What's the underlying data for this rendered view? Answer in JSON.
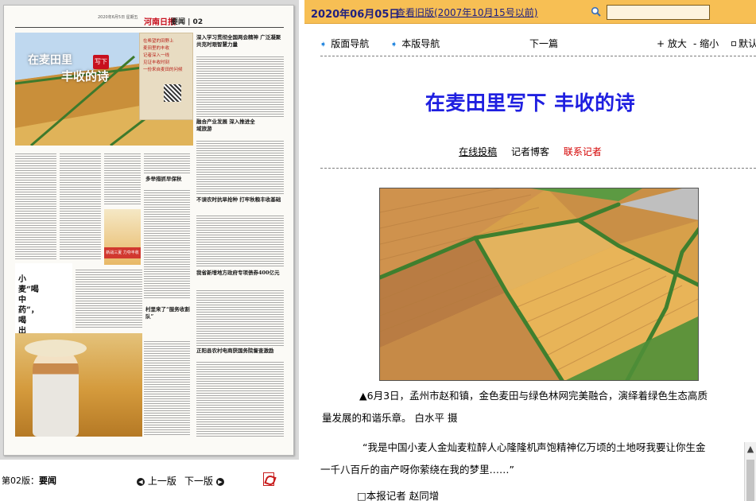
{
  "paper": {
    "masthead_date": "2020年6月5日 星期五",
    "brand": "河南日报",
    "section": "要闻 | 02",
    "hero_title_line1": "在麦田里",
    "hero_title_seal": "写下",
    "hero_title_line2": "丰收的诗",
    "side_box_lines": [
      "在希望的田野上",
      "麦田里的丰收",
      "记者深入一线",
      "见证丰收时刻",
      "一份来自麦田的问候"
    ],
    "headlines": [
      "深入学习贯彻全国两会精神 广泛凝聚共克时艰智慧力量",
      "融合产业发展 深入推进全域旅游",
      "多举措抓早保秋",
      "不误农时抗旱抢种 打牢秋粮丰收基础",
      "我省新增地方政府专项债券400亿元",
      "村里来了“服务收割队”",
      "正阳县农村电商获国务院督查激励"
    ],
    "sub_big_text": "小麦“喝中药”，喝出啥疗效？",
    "banner_text": "新战三夏 力夺丰收"
  },
  "left_footer": {
    "edition_prefix": "第02版：",
    "edition_name": "要闻",
    "prev_label": "上一版",
    "next_label": "下一版",
    "prev_icon": "round-left-arrow-icon",
    "next_icon": "round-right-arrow-icon",
    "pdf_icon": "pdf-icon"
  },
  "top_bar": {
    "date": "2020年06月05日",
    "old_version_link": "查看旧版(2007年10月15号以前)",
    "search_icon": "search-icon",
    "search_value": ""
  },
  "nav": {
    "version_nav": "版面导航",
    "article_nav": "本版导航",
    "next_article": "下一篇",
    "zoom_in": "+ 放大",
    "zoom_out": "- 缩小",
    "default_size": "默认"
  },
  "article": {
    "title": "在麦田里写下 丰收的诗",
    "online_submit": "在线投稿",
    "reporter_blog": "记者博客",
    "contact_reporter": "联系记者",
    "photo_alt": "孟州市赵和镇麦田与绿色林网航拍",
    "caption_line1": "▲6月3日，孟州市赵和镇，金色麦田与绿色林网完美融合，演绎着绿色生态高质",
    "caption_line2": "量发展的和谐乐章。 白水平 摄",
    "quote_line1": "“我是中国小麦人金灿麦粒醉人心隆隆机声饱精神亿万顷的土地呀我要让你生金",
    "quote_line2": "一千八百斤的亩产呀你萦绕在我的梦里……”",
    "reporter_line": "□本报记者 赵同增"
  },
  "colors": {
    "top_bar_bg": "#f7bf54",
    "title_blue": "#1f1fe0",
    "contact_red": "#d40000",
    "nav_arrow_blue": "#2a8ae0"
  }
}
